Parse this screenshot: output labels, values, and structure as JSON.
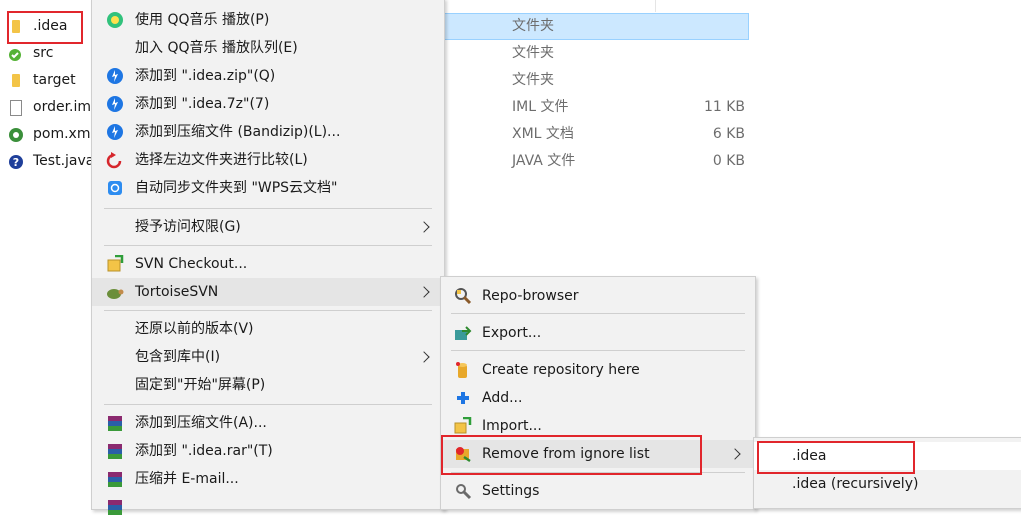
{
  "files": [
    {
      "name": ".idea",
      "type": "文件夹",
      "size": "",
      "icon": "folder-icon"
    },
    {
      "name": "src",
      "type": "文件夹",
      "size": "",
      "icon": "svn-folder-icon"
    },
    {
      "name": "target",
      "type": "文件夹",
      "size": "",
      "icon": "folder-icon"
    },
    {
      "name": "order.im",
      "type": "IML 文件",
      "size": "11 KB",
      "icon": "document-icon"
    },
    {
      "name": "pom.xm",
      "type": "XML 文档",
      "size": "6 KB",
      "icon": "xml-file-icon"
    },
    {
      "name": "Test.java",
      "type": "JAVA 文件",
      "size": "0 KB",
      "icon": "java-file-icon"
    }
  ],
  "context_menu": [
    {
      "label": "使用 QQ音乐 播放(P)",
      "icon": "qq-music-icon"
    },
    {
      "label": "加入 QQ音乐 播放队列(E)",
      "icon": ""
    },
    {
      "label": "添加到 \".idea.zip\"(Q)",
      "icon": "bandizip-icon"
    },
    {
      "label": "添加到 \".idea.7z\"(7)",
      "icon": "bandizip-icon"
    },
    {
      "label": "添加到压缩文件 (Bandizip)(L)...",
      "icon": "bandizip-icon"
    },
    {
      "label": "选择左边文件夹进行比较(L)",
      "icon": "compare-icon"
    },
    {
      "label": "自动同步文件夹到 \"WPS云文档\"",
      "icon": "wps-cloud-icon"
    },
    {
      "label": "授予访问权限(G)",
      "icon": ""
    },
    {
      "label": "SVN Checkout...",
      "icon": "svn-checkout-icon"
    },
    {
      "label": "TortoiseSVN",
      "icon": "tortoise-icon"
    },
    {
      "label": "还原以前的版本(V)",
      "icon": ""
    },
    {
      "label": "包含到库中(I)",
      "icon": ""
    },
    {
      "label": "固定到\"开始\"屏幕(P)",
      "icon": ""
    },
    {
      "label": "添加到压缩文件(A)...",
      "icon": "winrar-icon"
    },
    {
      "label": "添加到 \".idea.rar\"(T)",
      "icon": "winrar-icon"
    },
    {
      "label": "压缩并 E-mail...",
      "icon": "winrar-icon"
    }
  ],
  "svn_menu": [
    {
      "label": "Repo-browser",
      "icon": "repo-browser-icon"
    },
    {
      "label": "Export...",
      "icon": "export-icon"
    },
    {
      "label": "Create repository here",
      "icon": "create-repo-icon"
    },
    {
      "label": "Add...",
      "icon": "add-icon"
    },
    {
      "label": "Import...",
      "icon": "import-icon"
    },
    {
      "label": "Remove from ignore list",
      "icon": "remove-ignore-icon"
    },
    {
      "label": "Settings",
      "icon": "settings-icon"
    }
  ],
  "ignore_menu": [
    {
      "label": ".idea"
    },
    {
      "label": ".idea (recursively)"
    }
  ],
  "colors": {
    "selection": "#cce8ff",
    "highlight_outline": "#e1262c",
    "menu_bg": "#f2f2f2",
    "folder": "#f3c447"
  }
}
